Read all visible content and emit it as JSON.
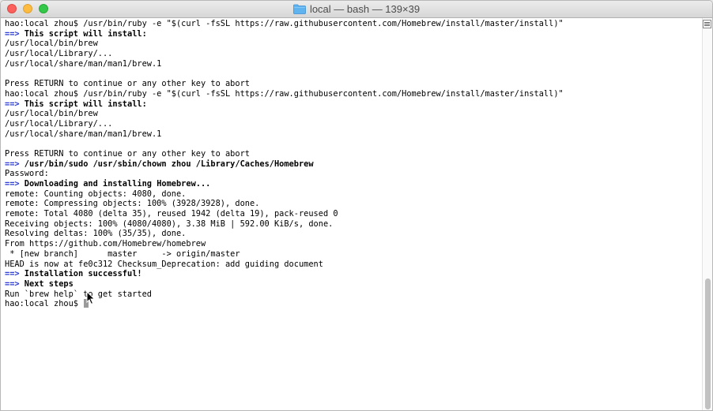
{
  "window": {
    "title": "local — bash — 139×39",
    "folder_icon": "folder-icon",
    "folder_color": "#5fb4f0"
  },
  "terminal": {
    "lines": [
      {
        "parts": [
          {
            "t": "hao:local zhou$ /usr/bin/ruby -e \"$(curl -fsSL https://raw.githubusercontent.com/Homebrew/install/master/install)\"",
            "s": ""
          }
        ]
      },
      {
        "parts": [
          {
            "t": "==>",
            "s": "arrow"
          },
          {
            "t": " This script will install:",
            "s": "bold"
          }
        ]
      },
      {
        "parts": [
          {
            "t": "/usr/local/bin/brew",
            "s": ""
          }
        ]
      },
      {
        "parts": [
          {
            "t": "/usr/local/Library/...",
            "s": ""
          }
        ]
      },
      {
        "parts": [
          {
            "t": "/usr/local/share/man/man1/brew.1",
            "s": ""
          }
        ]
      },
      {
        "parts": [
          {
            "t": "",
            "s": ""
          }
        ]
      },
      {
        "parts": [
          {
            "t": "Press RETURN to continue or any other key to abort",
            "s": ""
          }
        ]
      },
      {
        "parts": [
          {
            "t": "hao:local zhou$ /usr/bin/ruby -e \"$(curl -fsSL https://raw.githubusercontent.com/Homebrew/install/master/install)\"",
            "s": ""
          }
        ]
      },
      {
        "parts": [
          {
            "t": "==>",
            "s": "arrow"
          },
          {
            "t": " This script will install:",
            "s": "bold"
          }
        ]
      },
      {
        "parts": [
          {
            "t": "/usr/local/bin/brew",
            "s": ""
          }
        ]
      },
      {
        "parts": [
          {
            "t": "/usr/local/Library/...",
            "s": ""
          }
        ]
      },
      {
        "parts": [
          {
            "t": "/usr/local/share/man/man1/brew.1",
            "s": ""
          }
        ]
      },
      {
        "parts": [
          {
            "t": "",
            "s": ""
          }
        ]
      },
      {
        "parts": [
          {
            "t": "Press RETURN to continue or any other key to abort",
            "s": ""
          }
        ]
      },
      {
        "parts": [
          {
            "t": "==>",
            "s": "arrow"
          },
          {
            "t": " /usr/bin/sudo /usr/sbin/chown zhou /Library/Caches/Homebrew",
            "s": "bold"
          }
        ]
      },
      {
        "parts": [
          {
            "t": "Password:",
            "s": ""
          }
        ]
      },
      {
        "parts": [
          {
            "t": "==>",
            "s": "arrow"
          },
          {
            "t": " Downloading and installing Homebrew...",
            "s": "bold"
          }
        ]
      },
      {
        "parts": [
          {
            "t": "remote: Counting objects: 4080, done.",
            "s": ""
          }
        ]
      },
      {
        "parts": [
          {
            "t": "remote: Compressing objects: 100% (3928/3928), done.",
            "s": ""
          }
        ]
      },
      {
        "parts": [
          {
            "t": "remote: Total 4080 (delta 35), reused 1942 (delta 19), pack-reused 0",
            "s": ""
          }
        ]
      },
      {
        "parts": [
          {
            "t": "Receiving objects: 100% (4080/4080), 3.38 MiB | 592.00 KiB/s, done.",
            "s": ""
          }
        ]
      },
      {
        "parts": [
          {
            "t": "Resolving deltas: 100% (35/35), done.",
            "s": ""
          }
        ]
      },
      {
        "parts": [
          {
            "t": "From https://github.com/Homebrew/homebrew",
            "s": ""
          }
        ]
      },
      {
        "parts": [
          {
            "t": " * [new branch]      master     -> origin/master",
            "s": ""
          }
        ]
      },
      {
        "parts": [
          {
            "t": "HEAD is now at fe0c312 Checksum_Deprecation: add guiding document",
            "s": ""
          }
        ]
      },
      {
        "parts": [
          {
            "t": "==>",
            "s": "arrow"
          },
          {
            "t": " Installation successful!",
            "s": "bold"
          }
        ]
      },
      {
        "parts": [
          {
            "t": "==>",
            "s": "arrow"
          },
          {
            "t": " Next steps",
            "s": "bold"
          }
        ]
      },
      {
        "parts": [
          {
            "t": "Run `brew help` to get started",
            "s": ""
          }
        ]
      }
    ],
    "prompt": "hao:local zhou$ "
  },
  "colors": {
    "arrow": "#2a3bd8",
    "text": "#000000",
    "background": "#ffffff"
  }
}
